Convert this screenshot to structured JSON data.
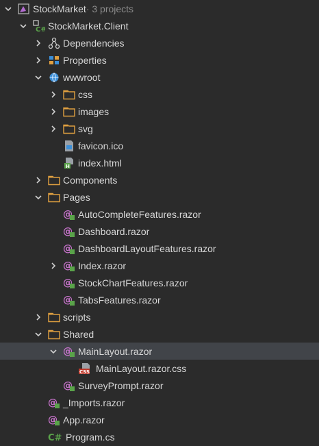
{
  "solution": {
    "name": "StockMarket",
    "suffix": " · 3 projects"
  },
  "rows": [
    {
      "level": 0,
      "chevron": "down",
      "icon": "solution",
      "label": "StockMarket",
      "suffix": " · 3 projects"
    },
    {
      "level": 1,
      "chevron": "down",
      "icon": "csproj",
      "label": "StockMarket.Client"
    },
    {
      "level": 2,
      "chevron": "right",
      "icon": "dependencies",
      "label": "Dependencies"
    },
    {
      "level": 2,
      "chevron": "right",
      "icon": "properties",
      "label": "Properties"
    },
    {
      "level": 2,
      "chevron": "down",
      "icon": "globe",
      "label": "wwwroot"
    },
    {
      "level": 3,
      "chevron": "right",
      "icon": "folder",
      "label": "css"
    },
    {
      "level": 3,
      "chevron": "right",
      "icon": "folder",
      "label": "images"
    },
    {
      "level": 3,
      "chevron": "right",
      "icon": "folder",
      "label": "svg"
    },
    {
      "level": 3,
      "chevron": "none",
      "icon": "favicon",
      "label": "favicon.ico"
    },
    {
      "level": 3,
      "chevron": "none",
      "icon": "html",
      "label": "index.html"
    },
    {
      "level": 2,
      "chevron": "right",
      "icon": "folder",
      "label": "Components"
    },
    {
      "level": 2,
      "chevron": "down",
      "icon": "folder",
      "label": "Pages"
    },
    {
      "level": 3,
      "chevron": "none",
      "icon": "razor",
      "label": "AutoCompleteFeatures.razor"
    },
    {
      "level": 3,
      "chevron": "none",
      "icon": "razor",
      "label": "Dashboard.razor"
    },
    {
      "level": 3,
      "chevron": "none",
      "icon": "razor",
      "label": "DashboardLayoutFeatures.razor"
    },
    {
      "level": 3,
      "chevron": "right",
      "icon": "razor",
      "label": "Index.razor"
    },
    {
      "level": 3,
      "chevron": "none",
      "icon": "razor",
      "label": "StockChartFeatures.razor"
    },
    {
      "level": 3,
      "chevron": "none",
      "icon": "razor",
      "label": "TabsFeatures.razor"
    },
    {
      "level": 2,
      "chevron": "right",
      "icon": "folder",
      "label": "scripts"
    },
    {
      "level": 2,
      "chevron": "down",
      "icon": "folder",
      "label": "Shared"
    },
    {
      "level": 3,
      "chevron": "down",
      "icon": "razor",
      "label": "MainLayout.razor",
      "selected": true
    },
    {
      "level": 4,
      "chevron": "none",
      "icon": "css",
      "label": "MainLayout.razor.css"
    },
    {
      "level": 3,
      "chevron": "none",
      "icon": "razor",
      "label": "SurveyPrompt.razor"
    },
    {
      "level": 2,
      "chevron": "none",
      "icon": "razor",
      "label": "_Imports.razor"
    },
    {
      "level": 2,
      "chevron": "none",
      "icon": "razor",
      "label": "App.razor"
    },
    {
      "level": 2,
      "chevron": "none",
      "icon": "csharp",
      "label": "Program.cs"
    }
  ],
  "colors": {
    "background": "#2b2b2b",
    "selected_row": "#414449",
    "folder": "#e0a040",
    "razor": "#c874cc",
    "csharp": "#5aa34a"
  }
}
